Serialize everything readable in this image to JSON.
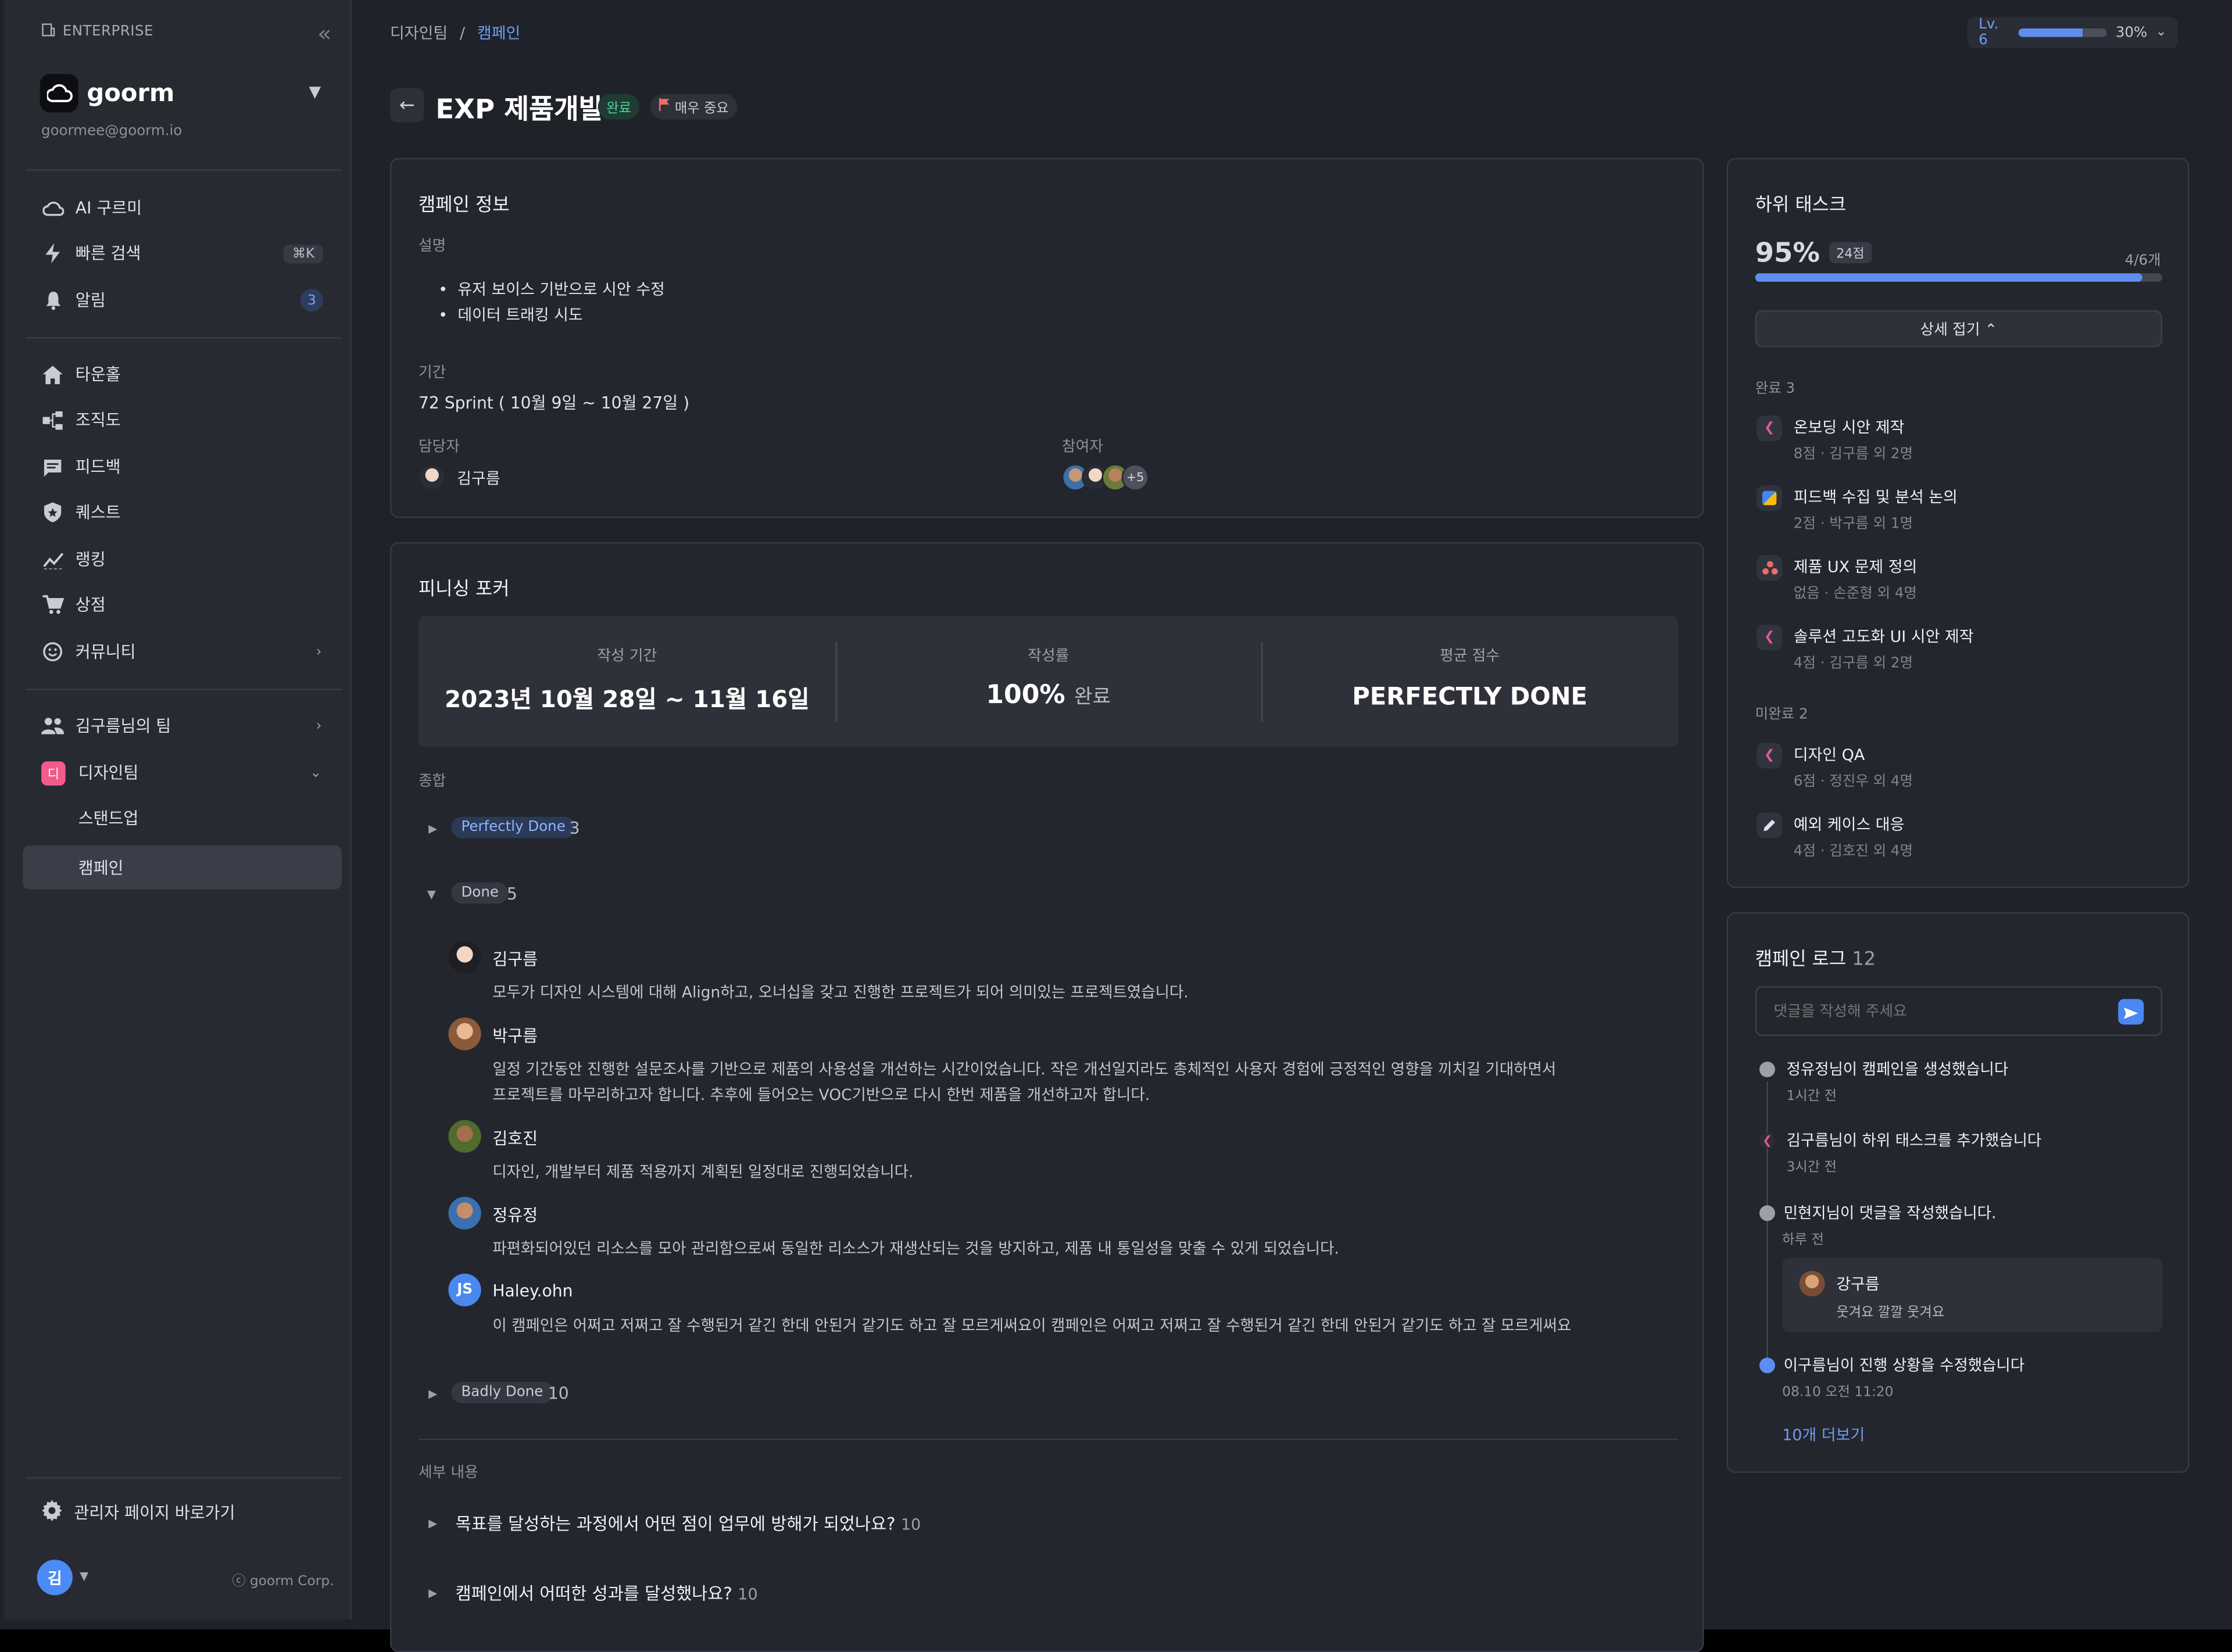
{
  "sidebar": {
    "enterprise_label": "ENTERPRISE",
    "org_name": "goorm",
    "email": "goormee@goorm.io",
    "menu": [
      {
        "label": "AI 구르미"
      },
      {
        "label": "빠른 검색",
        "shortcut": "⌘K"
      },
      {
        "label": "알림",
        "badge": "3"
      }
    ],
    "nav": [
      {
        "label": "타운홀"
      },
      {
        "label": "조직도"
      },
      {
        "label": "피드백"
      },
      {
        "label": "퀘스트"
      },
      {
        "label": "랭킹"
      },
      {
        "label": "상점"
      },
      {
        "label": "커뮤니티"
      }
    ],
    "teams": [
      {
        "label": "김구름님의 팀"
      },
      {
        "label": "디자인팀",
        "icon_text": "디"
      }
    ],
    "team_sub": [
      {
        "label": "스탠드업"
      },
      {
        "label": "캠페인"
      }
    ],
    "admin_label": "관리자 페이지 바로가기",
    "user_initial": "김",
    "corp": "ⓒ goorm Corp."
  },
  "header": {
    "breadcrumb_parent": "디자인팀",
    "breadcrumb_sep": "/",
    "breadcrumb_current": "캠페인",
    "level": "Lv. 6",
    "level_percent": "30%",
    "level_progress": 0.72
  },
  "page": {
    "title": "EXP 제품개발",
    "status": "완료",
    "priority": "매우 중요"
  },
  "info": {
    "heading": "캠페인 정보",
    "desc_label": "설명",
    "bullets": [
      "유저 보이스 기반으로 시안 수정",
      "데이터 트래킹 시도"
    ],
    "period_label": "기간",
    "period": "72 Sprint ( 10월 9일 ~ 10월 27일 )",
    "owner_label": "담당자",
    "owner": "김구름",
    "participants_label": "참여자",
    "participants_more": "+5"
  },
  "poker": {
    "heading": "피니싱 포커",
    "stats": [
      {
        "label": "작성 기간",
        "value": "2023년 10월 28일 ~ 11월 16일"
      },
      {
        "label": "작성률",
        "value": "100%",
        "suffix": "완료"
      },
      {
        "label": "평균 점수",
        "value": "PERFECTLY DONE"
      }
    ],
    "summary_label": "종합",
    "groups": [
      {
        "tag": "Perfectly Done",
        "count": "3"
      },
      {
        "tag": "Done",
        "count": "5"
      },
      {
        "tag": "Badly Done",
        "count": "10"
      }
    ],
    "comments": [
      {
        "name": "김구름",
        "text": "모두가 디자인 시스템에 대해 Align하고, 오너십을 갖고 진행한 프로젝트가 되어 의미있는 프로젝트였습니다."
      },
      {
        "name": "박구름",
        "text1": "일정 기간동안 진행한 설문조사를 기반으로 제품의 사용성을 개선하는 시간이었습니다. 작은 개선일지라도 총체적인 사용자 경험에 긍정적인 영향을 끼치길 기대하면서",
        "text2": "프로젝트를 마무리하고자 합니다. 추후에 들어오는 VOC기반으로 다시 한번 제품을 개선하고자 합니다."
      },
      {
        "name": "김호진",
        "text": "디자인, 개발부터 제품 적용까지 계획된 일정대로 진행되었습니다."
      },
      {
        "name": "정유정",
        "text": "파편화되어있던 리소스를 모아 관리함으로써 동일한 리소스가 재생산되는 것을 방지하고, 제품 내 통일성을 맞출 수 있게 되었습니다."
      },
      {
        "name": "Haley.ohn",
        "initials": "JS",
        "text": "이 캠페인은 어쩌고 저쩌고 잘 수행된거 같긴 한데 안된거 같기도 하고 잘 모르게써요이 캠페인은 어쩌고 저쩌고 잘 수행된거 같긴 한데 안된거 같기도 하고 잘 모르게써요"
      }
    ],
    "detail_label": "세부 내용",
    "questions": [
      {
        "text": "목표를 달성하는 과정에서 어떤 점이 업무에 방해가 되었나요?",
        "count": "10"
      },
      {
        "text": "캠페인에서 어떠한 성과를 달성했나요?",
        "count": "10"
      }
    ]
  },
  "subtasks": {
    "heading": "하위 태스크",
    "percent": "95%",
    "points": "24점",
    "ratio": "4/6개",
    "progress": 0.95,
    "toggle_label": "상세 접기 ⌃",
    "done_label": "완료 3",
    "done": [
      {
        "title": "온보딩 시안 제작",
        "meta": "8점 · 김구름 외 2명"
      },
      {
        "title": "피드백 수집 및 분석 논의",
        "meta": "2점 · 박구름 외 1명"
      },
      {
        "title": "제품 UX 문제 정의",
        "meta": "없음 · 손준형 외 4명"
      },
      {
        "title": "솔루션 고도화 UI 시안 제작",
        "meta": "4점 · 김구름 외 2명"
      }
    ],
    "todo_label": "미완료 2",
    "todo": [
      {
        "title": "디자인 QA",
        "meta": "6점 · 정진우 외 4명"
      },
      {
        "title": "예외 케이스 대응",
        "meta": "4점 · 김호진 외 4명"
      }
    ]
  },
  "log": {
    "heading": "캠페인 로그",
    "count": "12",
    "placeholder": "댓글을 작성해 주세요",
    "items": [
      {
        "text": "정유정님이 캠페인을 생성했습니다",
        "time": "1시간 전"
      },
      {
        "text": "김구름님이 하위 태스크를 추가했습니다",
        "time": "3시간 전"
      },
      {
        "text": "민현지님이 댓글을 작성했습니다.",
        "time": "하루 전"
      },
      {
        "text": "이구름님이 진행 상황을 수정했습니다",
        "time": "08.10 오전 11:20"
      }
    ],
    "reply_name": "강구름",
    "reply_text": "웃겨요 깔깔 웃겨요",
    "more": "10개 더보기"
  },
  "colors": {
    "accent": "#5e8ff0",
    "done": "#51cf95",
    "bg": "#1f2229"
  }
}
